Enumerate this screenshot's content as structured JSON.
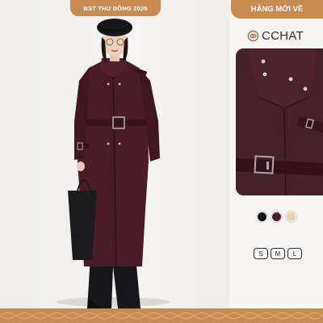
{
  "collection_badge": "BST THU ĐÔNG 2025",
  "new_arrivals_badge": "HÀNG MỚI VỀ",
  "brand": {
    "name": "CCHAT",
    "logo_icon": "knot-logo-icon"
  },
  "colors": {
    "accent": "#c98b50",
    "coat": "#4a1d26"
  },
  "color_options": [
    {
      "name": "black",
      "hex": "#111111"
    },
    {
      "name": "burgundy",
      "hex": "#4d1a26"
    },
    {
      "name": "beige",
      "hex": "#e6d4b2"
    }
  ],
  "sizes": [
    "S",
    "M",
    "L"
  ]
}
